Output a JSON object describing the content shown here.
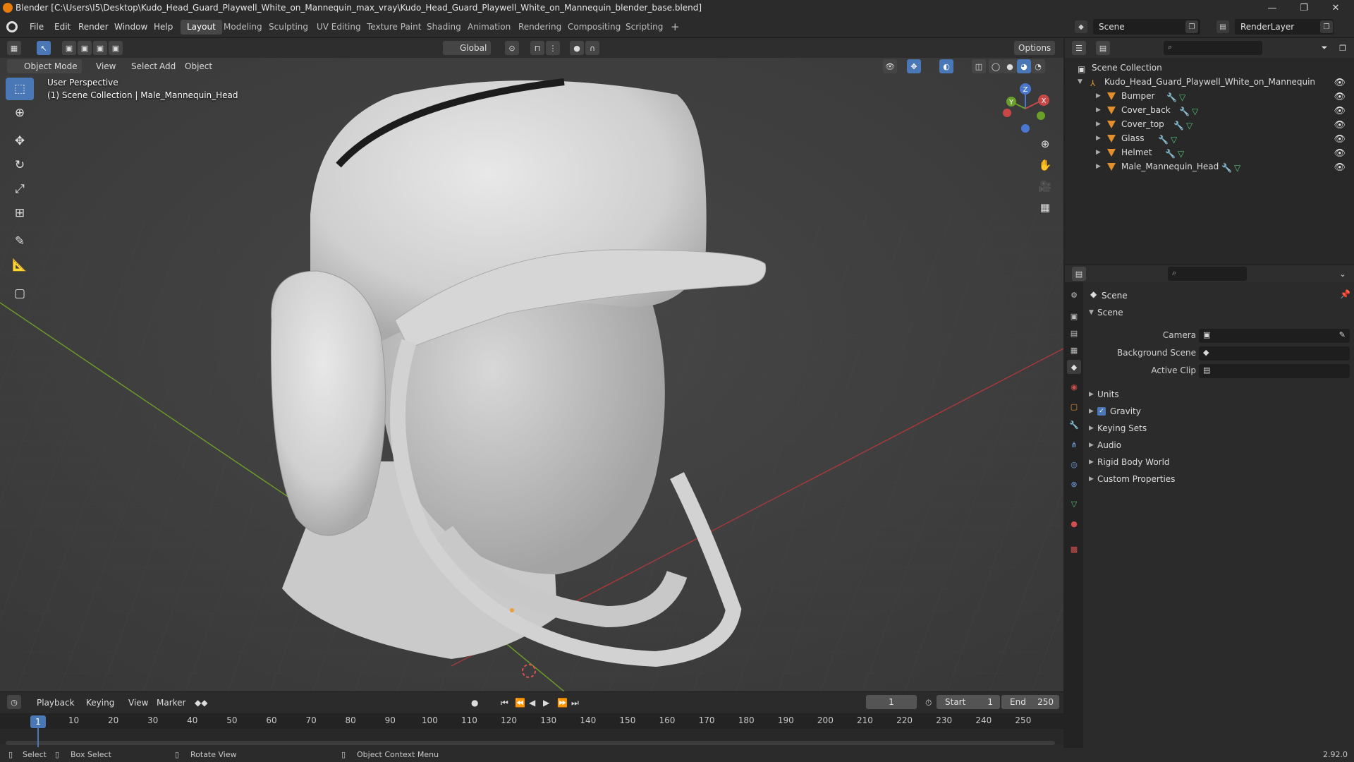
{
  "window": {
    "title": "Blender [C:\\Users\\I5\\Desktop\\Kudo_Head_Guard_Playwell_White_on_Mannequin_max_vray\\Kudo_Head_Guard_Playwell_White_on_Mannequin_blender_base.blend]",
    "minimize": "—",
    "maximize": "❐",
    "close": "✕"
  },
  "menus": [
    "File",
    "Edit",
    "Render",
    "Window",
    "Help"
  ],
  "workspaces": [
    "Layout",
    "Modeling",
    "Sculpting",
    "UV Editing",
    "Texture Paint",
    "Shading",
    "Animation",
    "Rendering",
    "Compositing",
    "Scripting"
  ],
  "workspace_add": "+",
  "scene_field": "Scene",
  "render_layer_field": "RenderLayer",
  "viewport": {
    "mode": "Object Mode",
    "menus": [
      "View",
      "Select",
      "Add",
      "Object"
    ],
    "orientation": "Global",
    "options": "Options",
    "perspective_text": "User Perspective",
    "collection_text": "(1) Scene Collection | Male_Mannequin_Head",
    "gizmo": {
      "x": "X",
      "y": "Y",
      "z": "Z"
    }
  },
  "outliner": {
    "root": "Scene Collection",
    "collection": "Kudo_Head_Guard_Playwell_White_on_Mannequin",
    "objects": [
      "Bumper",
      "Cover_back",
      "Cover_top",
      "Glass",
      "Helmet",
      "Male_Mannequin_Head"
    ]
  },
  "properties": {
    "context": "Scene",
    "panel": "Scene",
    "fields": [
      {
        "label": "Camera"
      },
      {
        "label": "Background Scene"
      },
      {
        "label": "Active Clip"
      }
    ],
    "subpanels": [
      "Units",
      "Gravity",
      "Keying Sets",
      "Audio",
      "Rigid Body World",
      "Custom Properties"
    ],
    "gravity_checked": true,
    "tab_colors": [
      "#bdbdbd",
      "#bdbdbd",
      "#bdbdbd",
      "#bdbdbd",
      "#e0e0e0",
      "#d24e4e",
      "#e28f2d",
      "#6aa0e0",
      "#6aa0e0",
      "#6aa0e0",
      "#6aa0e0",
      "#55c47a",
      "#d24e4e",
      "#d24e4e"
    ]
  },
  "timeline": {
    "menus": [
      "Playback",
      "Keying",
      "View",
      "Marker"
    ],
    "current_frame": "1",
    "start_label": "Start",
    "start": "1",
    "end_label": "End",
    "end": "250",
    "ticks": [
      "10",
      "20",
      "30",
      "40",
      "50",
      "60",
      "70",
      "80",
      "90",
      "100",
      "110",
      "120",
      "130",
      "140",
      "150",
      "160",
      "170",
      "180",
      "190",
      "200",
      "210",
      "220",
      "230",
      "240",
      "250"
    ],
    "frame_indicator": "1"
  },
  "statusbar": {
    "select": "Select",
    "box_select": "Box Select",
    "rotate_view": "Rotate View",
    "context_menu": "Object Context Menu",
    "version": "2.92.0"
  },
  "colors": {
    "accent": "#4a77b5",
    "object_icon": "#e28f2d",
    "grid_x_axis": "#a23a3a",
    "grid_y_axis": "#6a9a2a"
  }
}
